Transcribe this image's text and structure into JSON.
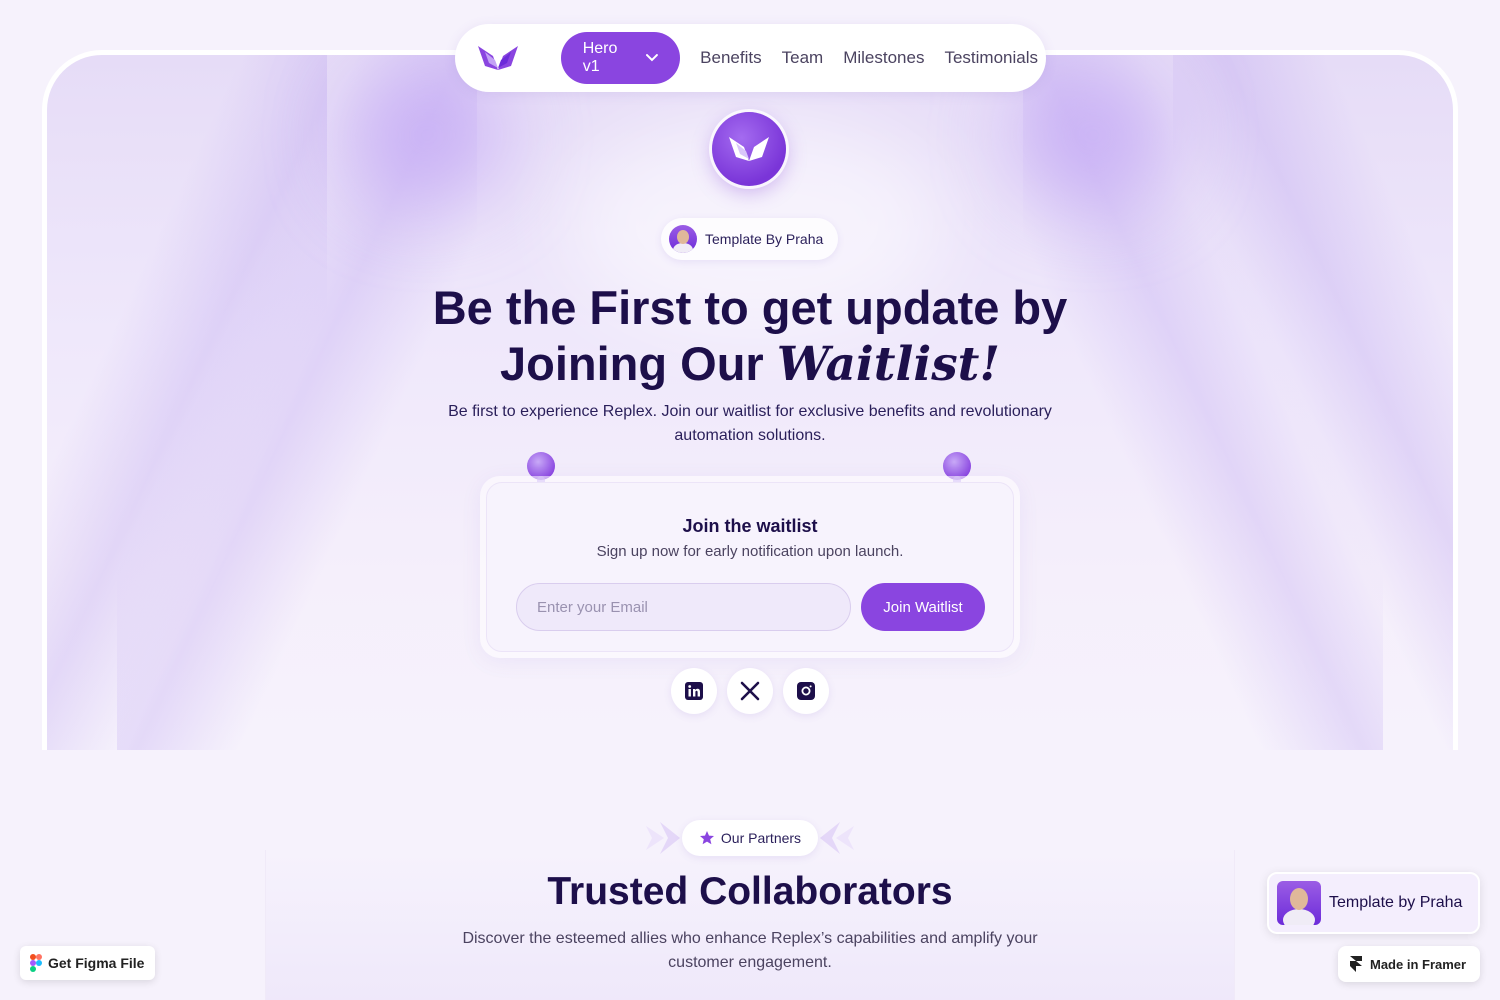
{
  "nav": {
    "active_item": "Hero v1",
    "links": [
      "Benefits",
      "Team",
      "Milestones",
      "Testimonials"
    ]
  },
  "hero": {
    "template_chip": "Template By Praha",
    "headline_line1": "Be the First to get update by",
    "headline_line2_prefix": "Joining Our ",
    "headline_line2_emphasis": "Waitlist!",
    "subheading": "Be first to experience Replex. Join our waitlist for exclusive benefits and revolutionary automation solutions."
  },
  "waitlist": {
    "title": "Join the waitlist",
    "subtitle": "Sign up now for early notification upon launch.",
    "email_placeholder": "Enter your Email",
    "button_label": "Join Waitlist"
  },
  "social": {
    "icons": [
      "linkedin-icon",
      "x-icon",
      "instagram-icon"
    ]
  },
  "partners": {
    "chip_label": "Our Partners",
    "title": "Trusted Collaborators",
    "subtitle": "Discover the esteemed allies who enhance Replex’s capabilities and amplify your customer engagement."
  },
  "widgets": {
    "figma_label": "Get Figma File",
    "praha_label": "Template by Praha",
    "framer_label": "Made in Framer"
  },
  "colors": {
    "accent": "#8a45e0",
    "heading": "#1d0f4a",
    "background": "#f6f2fc"
  }
}
